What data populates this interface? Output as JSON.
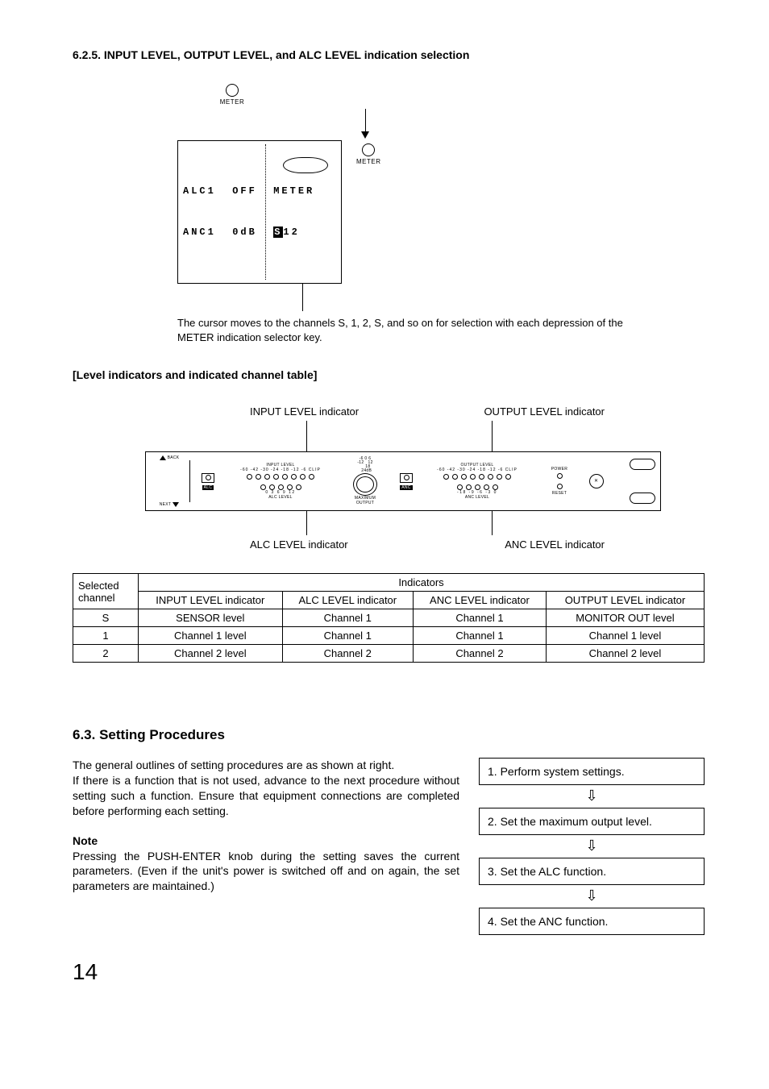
{
  "section_625_title": "6.2.5. INPUT LEVEL, OUTPUT LEVEL, and ALC LEVEL indication selection",
  "lcd": {
    "meter_label": "METER",
    "line1_left": "ALC1  OFF",
    "line1_right": "METER",
    "line2_left": "ANC1  0dB",
    "line2_inv": "S",
    "line2_after": "12",
    "caption": "The cursor moves to the channels S, 1, 2, S, and so on for selection with each depression of the METER indication selector key."
  },
  "sub_heading": "[Level indicators and indicated channel table]",
  "panel": {
    "top_left_label": "INPUT LEVEL indicator",
    "top_right_label": "OUTPUT LEVEL indicator",
    "bottom_left_label": "ALC LEVEL indicator",
    "bottom_right_label": "ANC LEVEL indicator",
    "back": "BACK",
    "next": "NEXT",
    "alc_btn": "ALC",
    "anc_btn": "ANC",
    "input_level": "INPUT LEVEL",
    "output_level": "OUTPUT LEVEL",
    "alc_level": "ALC LEVEL",
    "anc_level": "ANC LEVEL",
    "max_output": "MAXIMUM\nOUTPUT",
    "power": "POWER",
    "reset": "RESET",
    "scale_in": "-60 -42 -30 -24 -18 -12 -6 CLIP",
    "scale_out": "-60 -42 -30 -24 -18 -12 -6 CLIP",
    "scale_alc": "0   3   6   9   12",
    "scale_anc": "-18  -9  -6  -3   0",
    "knob_scale": "-6 0 6\n-12   12\n    18\n  24dB"
  },
  "table": {
    "hdr_selected": "Selected channel",
    "hdr_indicators": "Indicators",
    "cols": [
      "INPUT LEVEL indicator",
      "ALC LEVEL indicator",
      "ANC LEVEL indicator",
      "OUTPUT LEVEL indicator"
    ],
    "rows": [
      {
        "sel": "S",
        "c": [
          "SENSOR level",
          "Channel 1",
          "Channel 1",
          "MONITOR OUT level"
        ]
      },
      {
        "sel": "1",
        "c": [
          "Channel 1 level",
          "Channel 1",
          "Channel 1",
          "Channel 1 level"
        ]
      },
      {
        "sel": "2",
        "c": [
          "Channel 2 level",
          "Channel 2",
          "Channel 2",
          "Channel 2 level"
        ]
      }
    ]
  },
  "section_63_title": "6.3. Setting Procedures",
  "body1": "The general outlines of setting procedures are as shown at right.\nIf there is a function that is not used, advance to the next procedure without setting such a function. Ensure that equipment connections are completed before performing each setting.",
  "note_label": "Note",
  "body2": "Pressing the PUSH-ENTER knob during the setting saves the current parameters. (Even if the unit's power is switched off and on again, the set parameters are maintained.)",
  "flow": {
    "s1": "1. Perform system settings.",
    "s2": "2. Set the maximum output level.",
    "s3": "3. Set the ALC function.",
    "s4": "4. Set the ANC function."
  },
  "page_number": "14"
}
